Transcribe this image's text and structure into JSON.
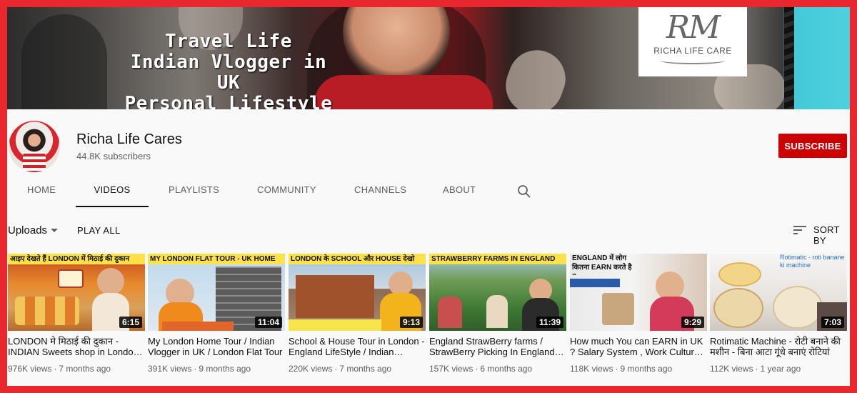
{
  "banner": {
    "lines": [
      "Travel Life",
      "Indian Vlogger in UK",
      "Personal Lifestyle"
    ],
    "logo_mark": "RM",
    "logo_text": "RICHA LIFE CARE"
  },
  "channel": {
    "name": "Richa Life Cares",
    "subscribers": "44.8K subscribers",
    "subscribe_label": "SUBSCRIBE"
  },
  "tabs": [
    "HOME",
    "VIDEOS",
    "PLAYLISTS",
    "COMMUNITY",
    "CHANNELS",
    "ABOUT"
  ],
  "active_tab": "VIDEOS",
  "toolbar": {
    "uploads_label": "Uploads",
    "play_all_label": "PLAY ALL",
    "sort_label": "SORT BY"
  },
  "videos": [
    {
      "thumb_text": "आइए देखते हैं LONDON में मिठाई की दुकान",
      "duration": "6:15",
      "title": "LONDON मे मिठाई की दुकान - INDIAN Sweets shop in London | Indian Sweets in UK",
      "views": "976K views",
      "age": "7 months ago"
    },
    {
      "thumb_text": "MY LONDON FLAT TOUR - UK HOME",
      "duration": "11:04",
      "title": "My London Home Tour / Indian Vlogger in UK / London Flat Tour",
      "views": "391K views",
      "age": "9 months ago"
    },
    {
      "thumb_text": "LONDON के SCHOOL और HOUSE देखो",
      "duration": "9:13",
      "title": "School & House Tour in London - England LifeStyle / Indian Vlogger",
      "views": "220K views",
      "age": "7 months ago"
    },
    {
      "thumb_text": "STRAWBERRY FARMS IN ENGLAND",
      "duration": "11:39",
      "title": "England StrawBerry farms / StrawBerry Picking In England / Indian Vlogger",
      "views": "157K views",
      "age": "6 months ago"
    },
    {
      "thumb_text": "ENGLAND में लोग कितना EARN करते है ?",
      "duration": "9:29",
      "title": "How much You can EARN in UK ? Salary System , Work Culture in England",
      "views": "118K views",
      "age": "9 months ago"
    },
    {
      "thumb_text": "Rotimatic - roti banane ki machine",
      "duration": "7:03",
      "title": "Rotimatic Machine - रोटी बनाने की मशीन - बिना आटा गूंधे बनाएं रोटियां",
      "views": "112K views",
      "age": "1 year ago"
    }
  ]
}
